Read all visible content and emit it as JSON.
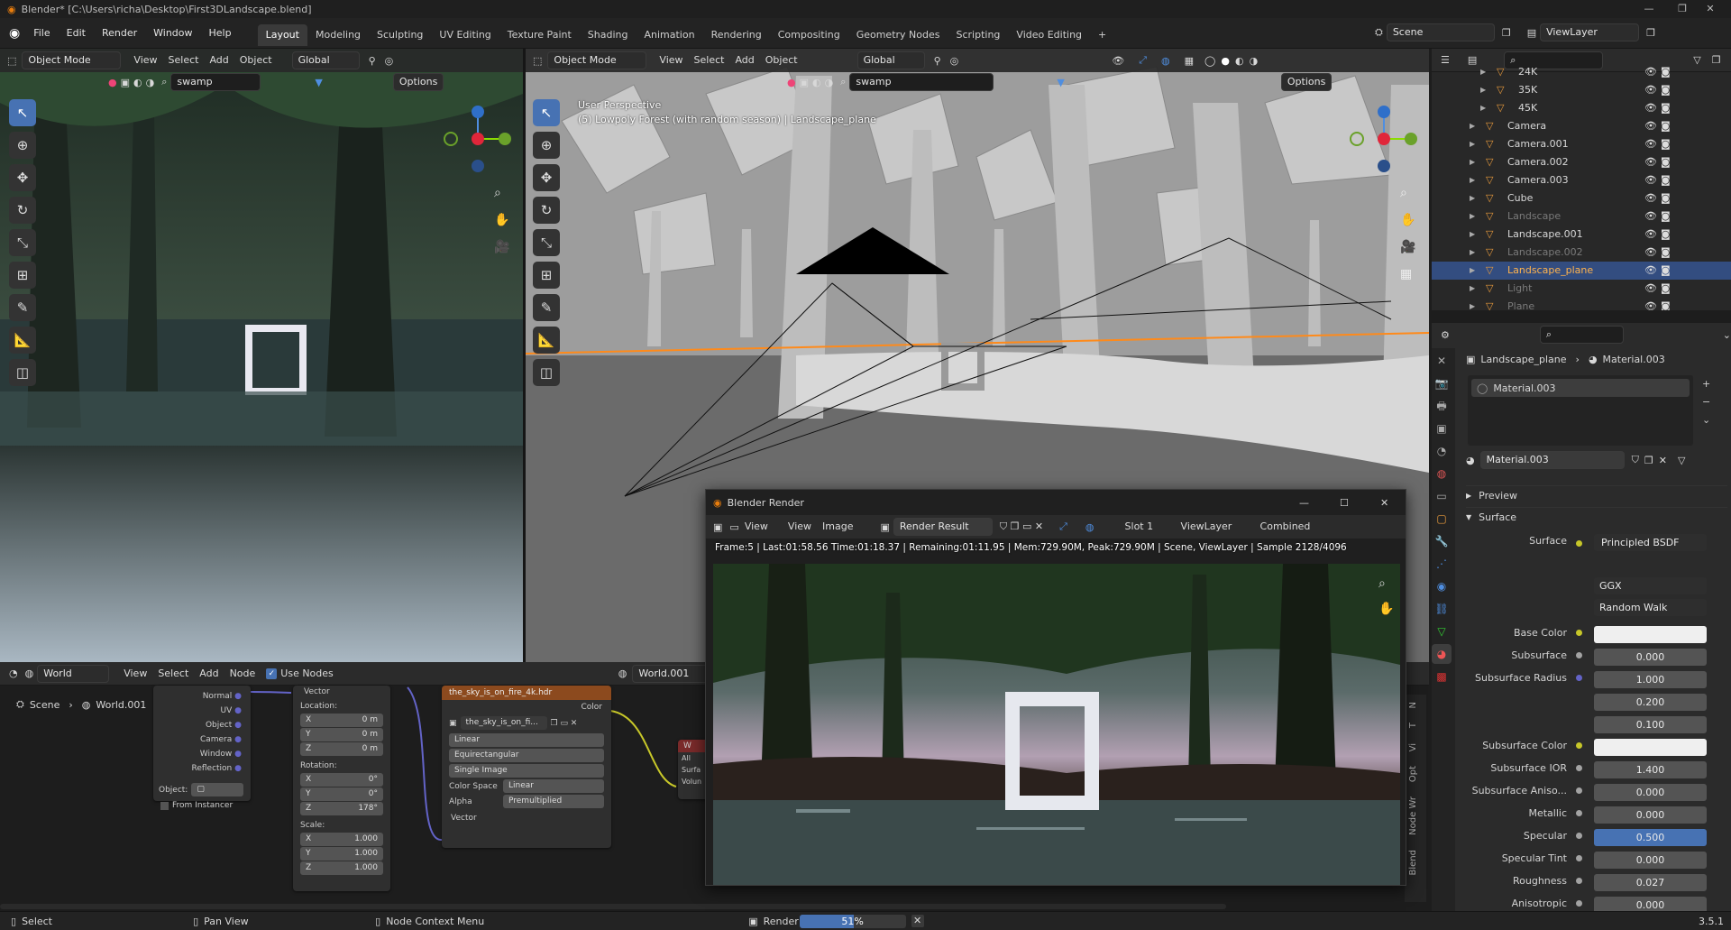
{
  "window": {
    "title": "Blender* [C:\\Users\\richa\\Desktop\\First3DLandscape.blend]",
    "controls": [
      "—",
      "❐",
      "✕"
    ]
  },
  "menu": {
    "items": [
      "File",
      "Edit",
      "Render",
      "Window",
      "Help"
    ],
    "workspaces": [
      "Layout",
      "Modeling",
      "Sculpting",
      "UV Editing",
      "Texture Paint",
      "Shading",
      "Animation",
      "Rendering",
      "Compositing",
      "Geometry Nodes",
      "Scripting",
      "Video Editing"
    ],
    "active_workspace": "Layout",
    "add_tab": "+",
    "scene": "Scene",
    "view_layer": "ViewLayer"
  },
  "viewport_left": {
    "mode": "Object Mode",
    "menus": [
      "View",
      "Select",
      "Add",
      "Object"
    ],
    "orientation": "Global",
    "world_search": "swamp",
    "options": "Options"
  },
  "viewport_main": {
    "mode": "Object Mode",
    "menus": [
      "View",
      "Select",
      "Add",
      "Object"
    ],
    "orientation": "Global",
    "world_search": "swamp",
    "options": "Options",
    "perspective": "User Perspective",
    "collection_info": "(5) Lowpoly Forest (with random season) | Landscape_plane"
  },
  "outliner": {
    "rows": [
      {
        "name": "24K",
        "dim": false,
        "selected": false,
        "indent": 1
      },
      {
        "name": "35K",
        "dim": false,
        "selected": false,
        "indent": 1
      },
      {
        "name": "45K",
        "dim": false,
        "selected": false,
        "indent": 1
      },
      {
        "name": "Camera",
        "dim": false,
        "selected": false,
        "indent": 0
      },
      {
        "name": "Camera.001",
        "dim": false,
        "selected": false,
        "indent": 0
      },
      {
        "name": "Camera.002",
        "dim": false,
        "selected": false,
        "indent": 0
      },
      {
        "name": "Camera.003",
        "dim": false,
        "selected": false,
        "indent": 0
      },
      {
        "name": "Cube",
        "dim": false,
        "selected": false,
        "indent": 0
      },
      {
        "name": "Landscape",
        "dim": true,
        "selected": false,
        "indent": 0
      },
      {
        "name": "Landscape.001",
        "dim": false,
        "selected": false,
        "indent": 0
      },
      {
        "name": "Landscape.002",
        "dim": true,
        "selected": false,
        "indent": 0
      },
      {
        "name": "Landscape_plane",
        "dim": false,
        "selected": true,
        "indent": 0
      },
      {
        "name": "Light",
        "dim": true,
        "selected": false,
        "indent": 0
      },
      {
        "name": "Plane",
        "dim": true,
        "selected": false,
        "indent": 0
      }
    ]
  },
  "properties": {
    "breadcrumb_object": "Landscape_plane",
    "breadcrumb_material": "Material.003",
    "slot_name": "Material.003",
    "material_name": "Material.003",
    "preview_label": "Preview",
    "surface_label": "Surface",
    "surface_shader_label": "Surface",
    "surface_shader": "Principled BSDF",
    "distribution": "GGX",
    "subsurface_method": "Random Walk",
    "fields": [
      {
        "label": "Base Color",
        "value": "",
        "type": "color-white",
        "dot": "y"
      },
      {
        "label": "Subsurface",
        "value": "0.000",
        "type": "num",
        "dot": "g"
      },
      {
        "label": "Subsurface Radius",
        "value": "1.000",
        "type": "num",
        "dot": "b"
      },
      {
        "label": "",
        "value": "0.200",
        "type": "num",
        "dot": ""
      },
      {
        "label": "",
        "value": "0.100",
        "type": "num",
        "dot": ""
      },
      {
        "label": "Subsurface Color",
        "value": "",
        "type": "color-white",
        "dot": "y"
      },
      {
        "label": "Subsurface IOR",
        "value": "1.400",
        "type": "num",
        "dot": "g"
      },
      {
        "label": "Subsurface Aniso...",
        "value": "0.000",
        "type": "num",
        "dot": "g"
      },
      {
        "label": "Metallic",
        "value": "0.000",
        "type": "num",
        "dot": "g"
      },
      {
        "label": "Specular",
        "value": "0.500",
        "type": "num-blue",
        "dot": "g"
      },
      {
        "label": "Specular Tint",
        "value": "0.000",
        "type": "num",
        "dot": "g"
      },
      {
        "label": "Roughness",
        "value": "0.027",
        "type": "num",
        "dot": "g"
      },
      {
        "label": "Anisotropic",
        "value": "0.000",
        "type": "num",
        "dot": "g"
      }
    ]
  },
  "node_editor": {
    "menus": [
      "View",
      "Select",
      "Add",
      "Node"
    ],
    "world_type": "World",
    "use_nodes": "Use Nodes",
    "world_name": "World.001",
    "breadcrumb_scene": "Scene",
    "breadcrumb_world": "World.001",
    "texcoord_outputs": [
      "Normal",
      "UV",
      "Object",
      "Camera",
      "Window",
      "Reflection"
    ],
    "texcoord_object_label": "Object:",
    "texcoord_from_instancer": "From Instancer",
    "mapping": {
      "vector": "Vector",
      "location": "Location:",
      "rotation": "Rotation:",
      "scale": "Scale:",
      "loc": [
        [
          "X",
          "0 m"
        ],
        [
          "Y",
          "0 m"
        ],
        [
          "Z",
          "0 m"
        ]
      ],
      "rot": [
        [
          "X",
          "0°"
        ],
        [
          "Y",
          "0°"
        ],
        [
          "Z",
          "178°"
        ]
      ],
      "scl": [
        [
          "X",
          "1.000"
        ],
        [
          "Y",
          "1.000"
        ],
        [
          "Z",
          "1.000"
        ]
      ]
    },
    "env": {
      "title": "the_sky_is_on_fire_4k.hdr",
      "color_out": "Color",
      "image": "the_sky_is_on_fi...",
      "interp": "Linear",
      "projection": "Equirectangular",
      "source": "Single Image",
      "colorspace_label": "Color Space",
      "colorspace": "Linear",
      "alpha_label": "Alpha",
      "alpha": "Premultiplied",
      "vector_in": "Vector"
    },
    "bg_node": {
      "title": "W",
      "all": "All",
      "surface": "Surfa",
      "volume": "Volun"
    },
    "side_tabs": [
      "N",
      "T",
      "Vi",
      "Opt",
      "Node Wr",
      "Blend"
    ]
  },
  "render_window": {
    "title": "Blender Render",
    "menus": [
      "View",
      "View",
      "Image"
    ],
    "result": "Render Result",
    "slot": "Slot 1",
    "view_layer": "ViewLayer",
    "pass": "Combined",
    "stats": "Frame:5 | Last:01:58.56 Time:01:18.37 | Remaining:01:11.95 | Mem:729.90M, Peak:729.90M | Scene, ViewLayer | Sample 2128/4096",
    "controls": [
      "—",
      "☐",
      "✕"
    ]
  },
  "status": {
    "select": "Select",
    "pan": "Pan View",
    "context": "Node Context Menu",
    "render_label": "Render",
    "progress_text": "51%",
    "progress": 0.51,
    "version": "3.5.1"
  },
  "colors": {
    "accent": "#4772b3",
    "selection_text": "#ffb34d",
    "env_header": "#8c4a1e",
    "texture_header": "#7a3a1a"
  }
}
